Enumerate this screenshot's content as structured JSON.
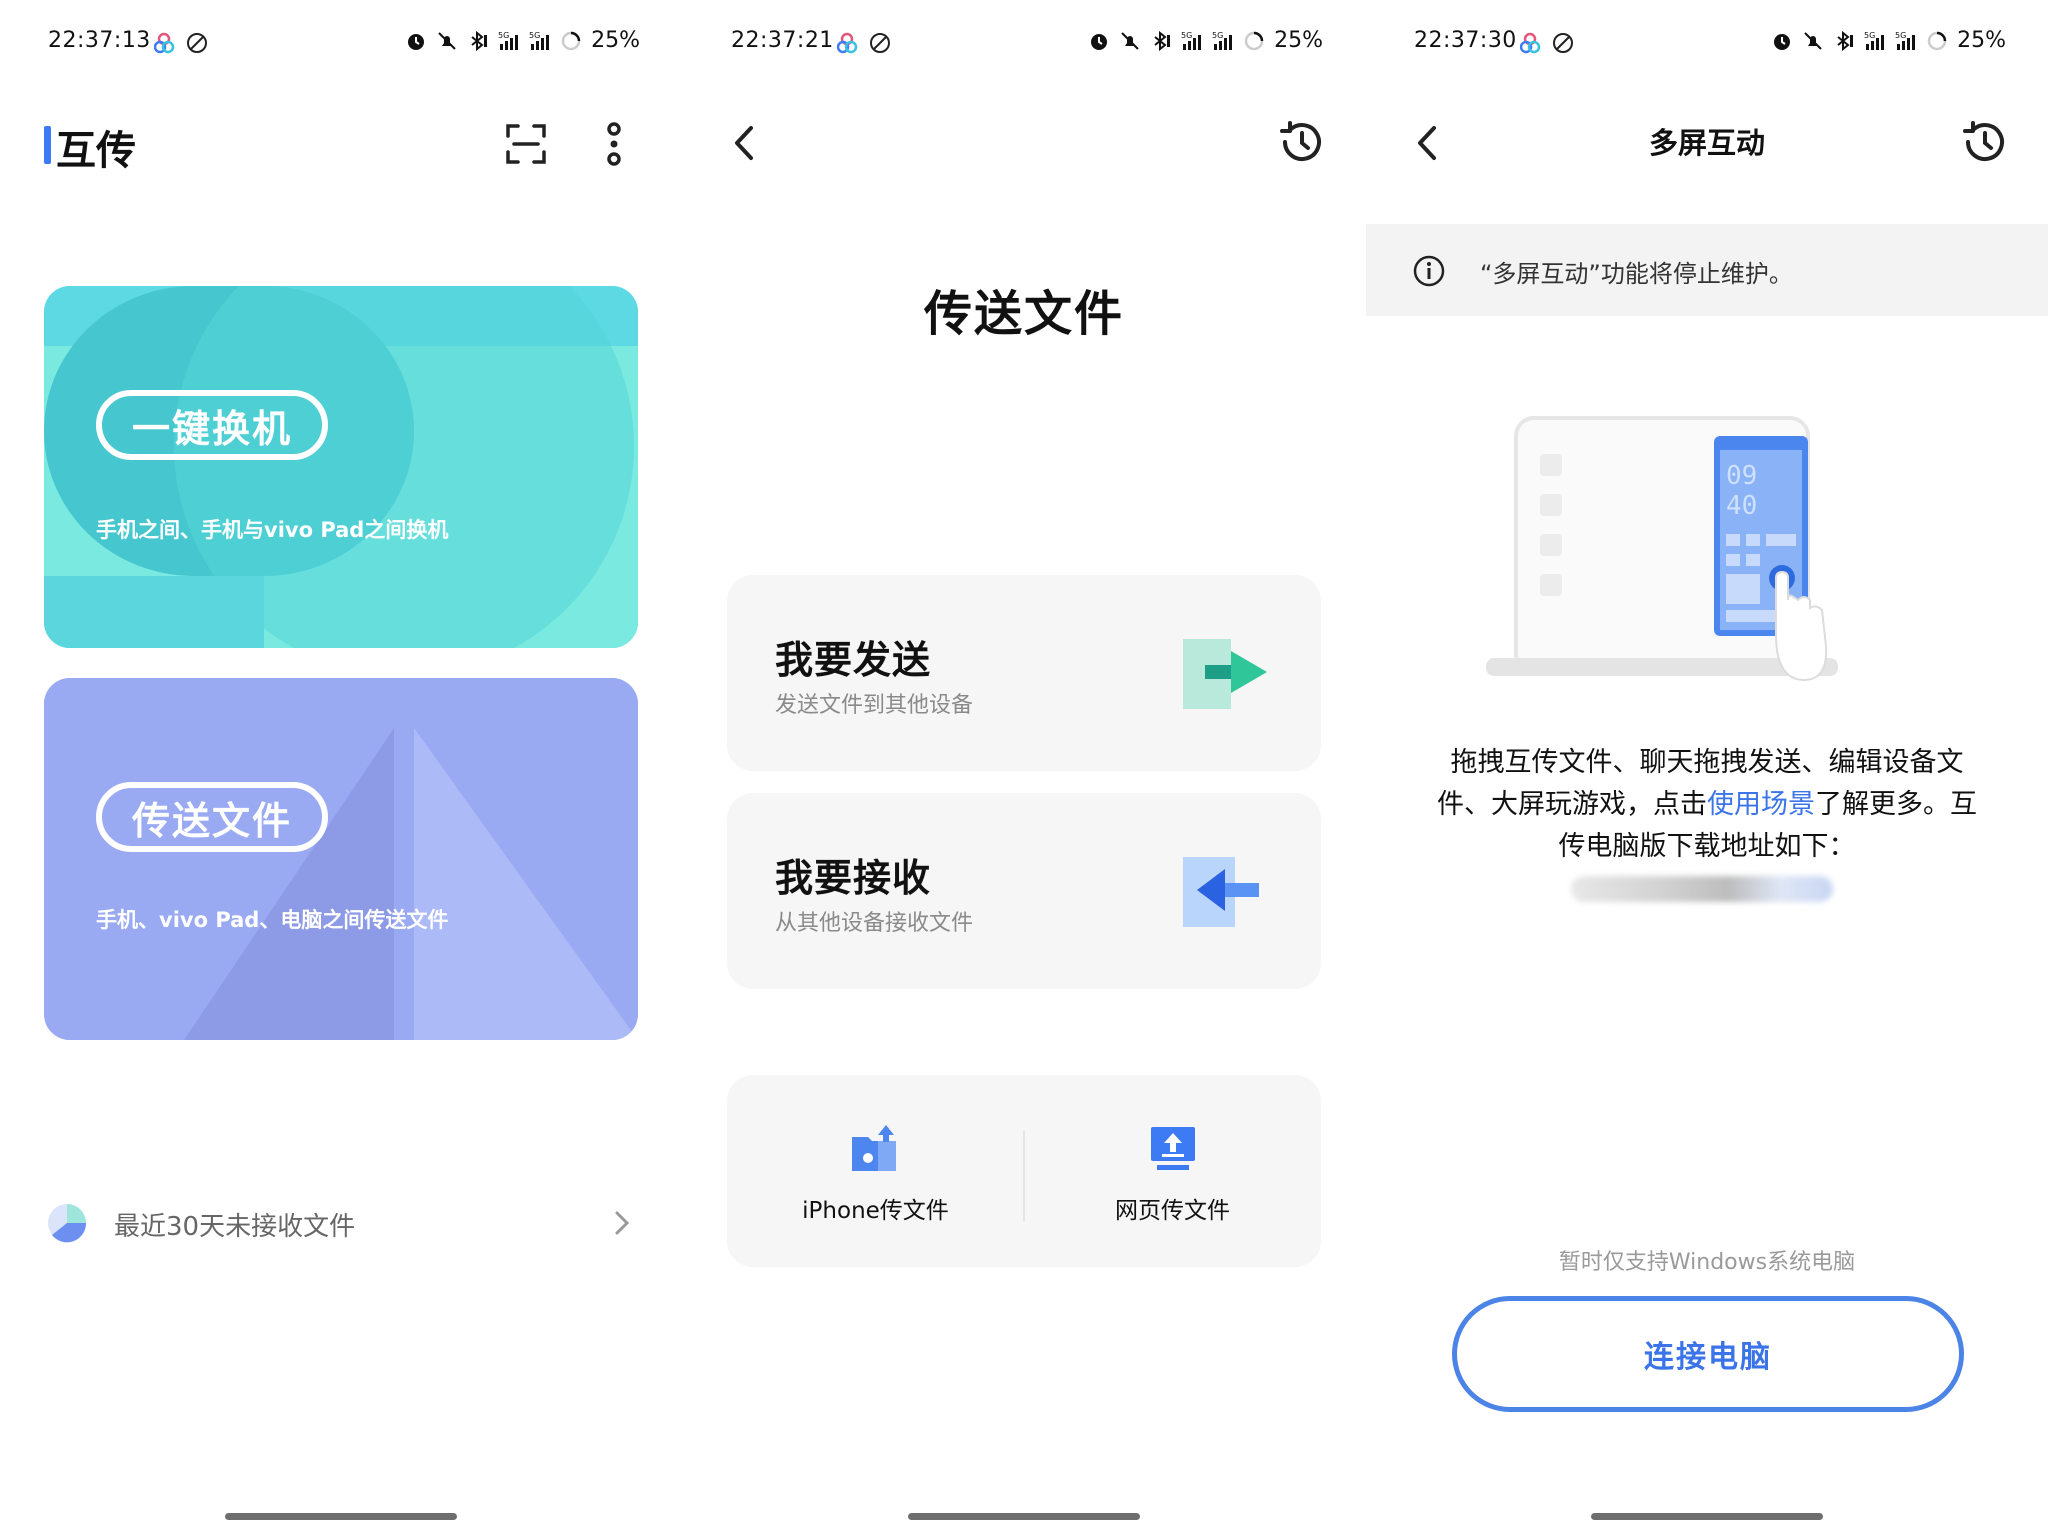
{
  "screens": [
    {
      "status": {
        "time": "22:37:13",
        "battery": "25%"
      },
      "title": "互传",
      "cards": [
        {
          "label": "一键换机",
          "subtitle": "手机之间、手机与vivo Pad之间换机",
          "color": "#5cd9e3"
        },
        {
          "label": "传送文件",
          "subtitle": "手机、vivo Pad、电脑之间传送文件",
          "color": "#9aaaf2"
        }
      ],
      "recent_label": "最近30天未接收文件",
      "icons": [
        "scan-icon",
        "more-icon",
        "pie-icon",
        "chevron-right-icon"
      ]
    },
    {
      "status": {
        "time": "22:37:21",
        "battery": "25%"
      },
      "title": "传送文件",
      "options": [
        {
          "title": "我要发送",
          "subtitle": "发送文件到其他设备",
          "icon": "send-arrow-icon"
        },
        {
          "title": "我要接收",
          "subtitle": "从其他设备接收文件",
          "icon": "receive-arrow-icon"
        }
      ],
      "bottom": [
        {
          "label": "iPhone传文件",
          "icon": "iphone-folder-icon"
        },
        {
          "label": "网页传文件",
          "icon": "web-upload-icon"
        }
      ]
    },
    {
      "status": {
        "time": "22:37:30",
        "battery": "25%"
      },
      "title": "多屏互动",
      "notice": "“多屏互动”功能将停止维护。",
      "desc_before": "拖拽互传文件、聊天拖拽发送、编辑设备文件、大屏玩游戏，点击",
      "desc_link": "使用场景",
      "desc_after": "了解更多。互传电脑版下载地址如下：",
      "windows_note": "暂时仅支持Windows系统电脑",
      "connect_label": "连接电脑",
      "illustration_clock": [
        "09",
        "40"
      ]
    }
  ],
  "colors": {
    "accent": "#3b74e8",
    "teal": "#5cd9e3",
    "lavender": "#9aaaf2",
    "send_green": "#2fc79a",
    "recv_blue": "#3d7bf5"
  }
}
